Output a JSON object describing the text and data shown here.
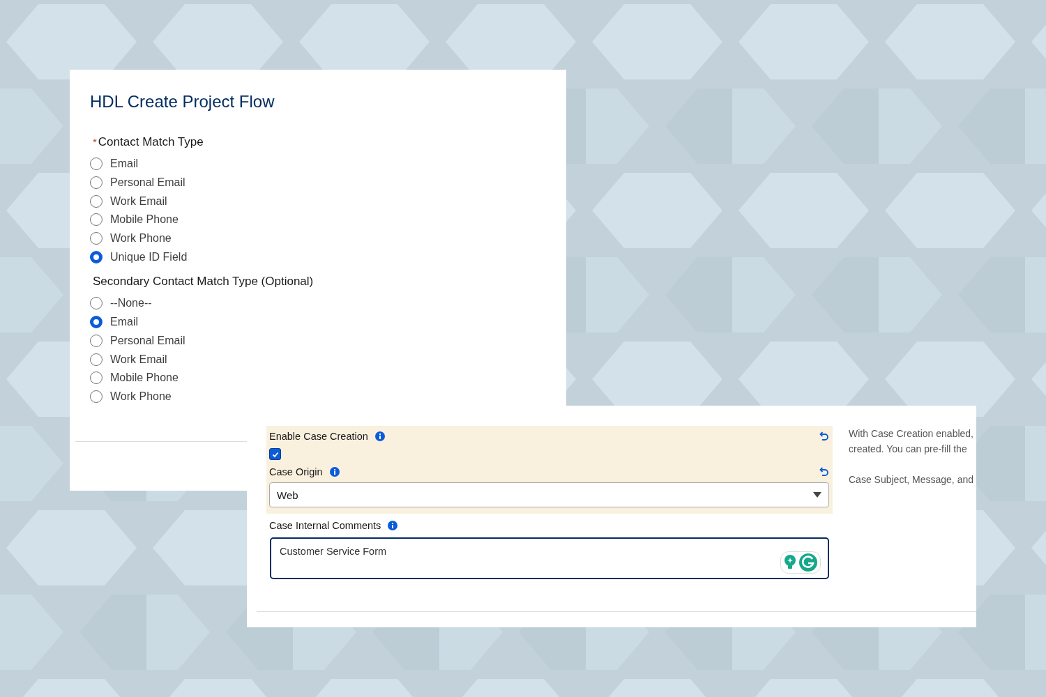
{
  "flow_panel": {
    "title": "HDL Create Project Flow",
    "groups": [
      {
        "label": "Contact Match Type",
        "required_mark": "*",
        "options": [
          {
            "label": "Email",
            "selected": false
          },
          {
            "label": "Personal Email",
            "selected": false
          },
          {
            "label": "Work Email",
            "selected": false
          },
          {
            "label": "Mobile Phone",
            "selected": false
          },
          {
            "label": "Work Phone",
            "selected": false
          },
          {
            "label": "Unique ID Field",
            "selected": true
          }
        ]
      },
      {
        "label": "Secondary Contact Match Type (Optional)",
        "options": [
          {
            "label": "--None--",
            "selected": false
          },
          {
            "label": "Email",
            "selected": true
          },
          {
            "label": "Personal Email",
            "selected": false
          },
          {
            "label": "Work Email",
            "selected": false
          },
          {
            "label": "Mobile Phone",
            "selected": false
          },
          {
            "label": "Work Phone",
            "selected": false
          }
        ]
      }
    ]
  },
  "case_panel": {
    "enable_case_creation": {
      "label": "Enable Case Creation",
      "checked": true
    },
    "case_origin": {
      "label": "Case Origin",
      "value": "Web"
    },
    "internal_comments": {
      "label": "Case Internal Comments",
      "value": "Customer Service Form"
    },
    "help_paragraphs": [
      {
        "lines": [
          "With Case Creation enabled,",
          "created. You can pre-fill the"
        ]
      },
      {
        "lines": [
          "Case Subject, Message, and"
        ]
      }
    ]
  }
}
